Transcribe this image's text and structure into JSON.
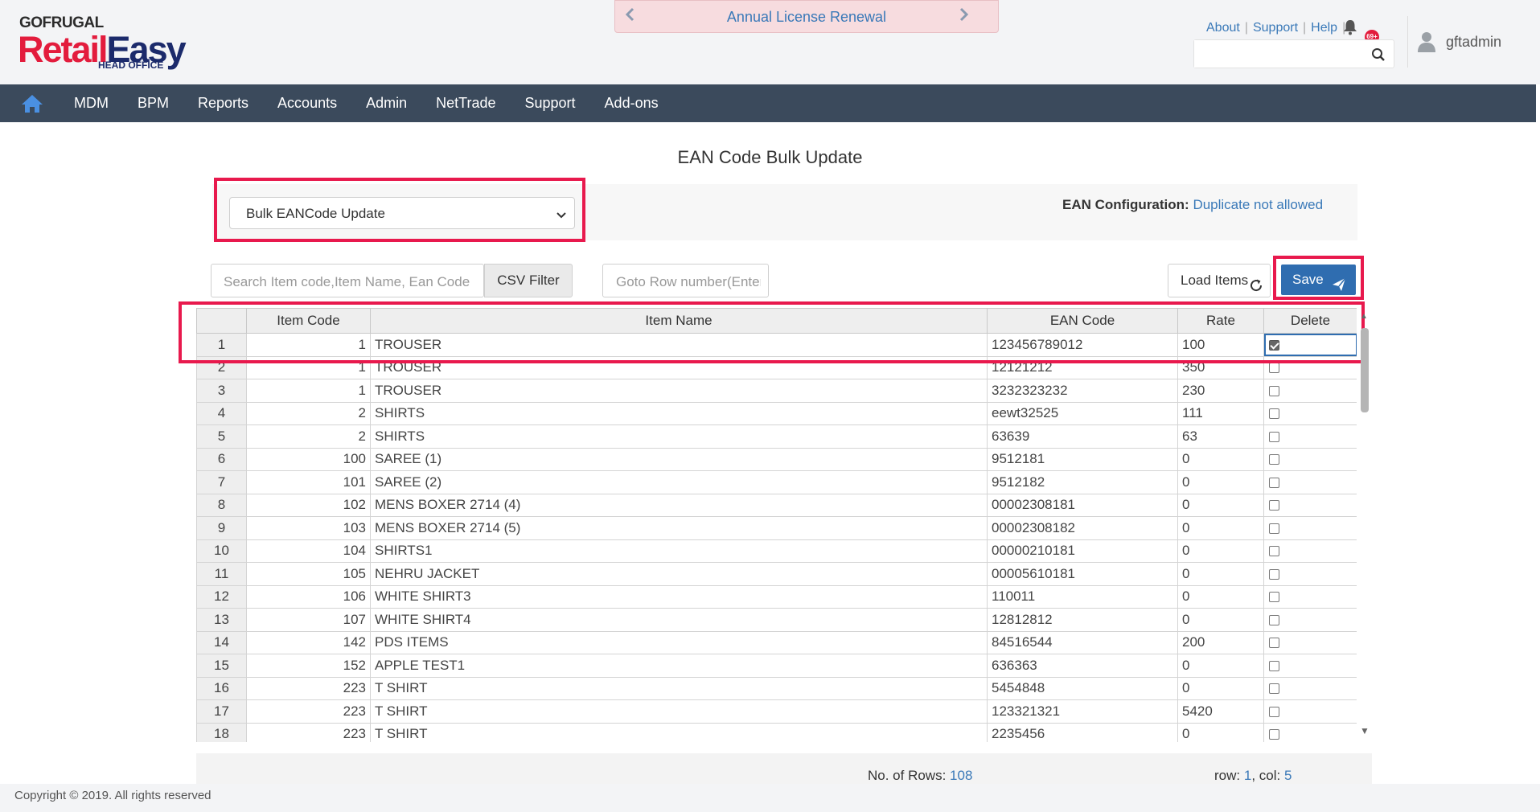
{
  "header": {
    "brand_top": "GOFRUGAL",
    "brand_main_a": "Retail",
    "brand_main_b": "Easy",
    "brand_sub": "HEAD OFFICE",
    "banner_label": "Annual License Renewal",
    "links": [
      "About",
      "Support",
      "Help"
    ],
    "notification_count": "69+",
    "username": "gftadmin"
  },
  "nav": {
    "items": [
      "MDM",
      "BPM",
      "Reports",
      "Accounts",
      "Admin",
      "NetTrade",
      "Support",
      "Add-ons"
    ]
  },
  "page": {
    "title": "EAN Code Bulk Update",
    "mode_select": "Bulk EANCode Update",
    "config_label": "EAN Configuration:",
    "config_value": "Duplicate not allowed"
  },
  "toolbar": {
    "search_placeholder": "Search Item code,Item Name, Ean Code",
    "csv_filter": "CSV Filter",
    "goto_placeholder": "Goto Row number(Enter)",
    "load_items": "Load Items",
    "save": "Save"
  },
  "grid": {
    "columns": [
      "",
      "Item Code",
      "Item Name",
      "EAN Code",
      "Rate",
      "Delete"
    ],
    "rows": [
      {
        "n": "1",
        "code": "1",
        "name": "TROUSER",
        "ean": "123456789012",
        "rate": "100",
        "del": true
      },
      {
        "n": "2",
        "code": "1",
        "name": "TROUSER",
        "ean": "12121212",
        "rate": "350",
        "del": false
      },
      {
        "n": "3",
        "code": "1",
        "name": "TROUSER",
        "ean": "3232323232",
        "rate": "230",
        "del": false
      },
      {
        "n": "4",
        "code": "2",
        "name": "SHIRTS",
        "ean": "eewt32525",
        "rate": "111",
        "del": false
      },
      {
        "n": "5",
        "code": "2",
        "name": "SHIRTS",
        "ean": "63639",
        "rate": "63",
        "del": false
      },
      {
        "n": "6",
        "code": "100",
        "name": "SAREE (1)",
        "ean": "9512181",
        "rate": "0",
        "del": false
      },
      {
        "n": "7",
        "code": "101",
        "name": "SAREE (2)",
        "ean": "9512182",
        "rate": "0",
        "del": false
      },
      {
        "n": "8",
        "code": "102",
        "name": "MENS BOXER 2714 (4)",
        "ean": "00002308181",
        "rate": "0",
        "del": false
      },
      {
        "n": "9",
        "code": "103",
        "name": "MENS BOXER 2714 (5)",
        "ean": "00002308182",
        "rate": "0",
        "del": false
      },
      {
        "n": "10",
        "code": "104",
        "name": "SHIRTS1",
        "ean": "00000210181",
        "rate": "0",
        "del": false
      },
      {
        "n": "11",
        "code": "105",
        "name": "NEHRU JACKET",
        "ean": "00005610181",
        "rate": "0",
        "del": false
      },
      {
        "n": "12",
        "code": "106",
        "name": "WHITE SHIRT3",
        "ean": "110011",
        "rate": "0",
        "del": false
      },
      {
        "n": "13",
        "code": "107",
        "name": "WHITE SHIRT4",
        "ean": "12812812",
        "rate": "0",
        "del": false
      },
      {
        "n": "14",
        "code": "142",
        "name": "PDS ITEMS",
        "ean": "84516544",
        "rate": "200",
        "del": false
      },
      {
        "n": "15",
        "code": "152",
        "name": "APPLE TEST1",
        "ean": "636363",
        "rate": "0",
        "del": false
      },
      {
        "n": "16",
        "code": "223",
        "name": "T SHIRT",
        "ean": "5454848",
        "rate": "0",
        "del": false
      },
      {
        "n": "17",
        "code": "223",
        "name": "T SHIRT",
        "ean": "123321321",
        "rate": "5420",
        "del": false
      },
      {
        "n": "18",
        "code": "223",
        "name": "T SHIRT",
        "ean": "2235456",
        "rate": "0",
        "del": false
      }
    ]
  },
  "status": {
    "rows_label": "No. of Rows:",
    "rows_value": "108",
    "row_label": "row:",
    "row_value": "1",
    "col_label": ", col:",
    "col_value": "5"
  },
  "footer": {
    "copyright": "Copyright © 2019. All rights reserved"
  },
  "colors": {
    "accent": "#2f6db0",
    "nav_bg": "#3b4a5c",
    "highlight": "#e8194d",
    "brand_red": "#e31c3d",
    "brand_navy": "#1b2a6b"
  }
}
